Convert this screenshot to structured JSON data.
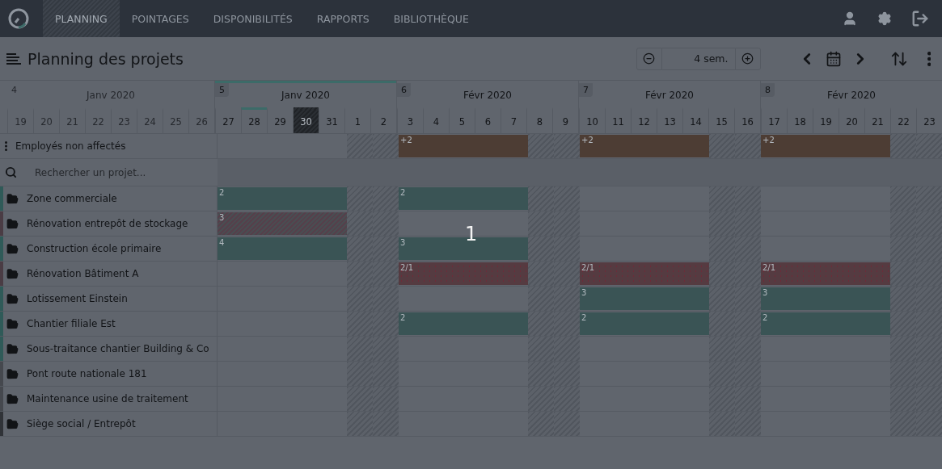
{
  "nav": {
    "tabs": [
      {
        "label": "PLANNING",
        "selected": true
      },
      {
        "label": "POINTAGES",
        "selected": false
      },
      {
        "label": "DISPONIBILITÉS",
        "selected": false
      },
      {
        "label": "RAPPORTS",
        "selected": false
      },
      {
        "label": "BIBLIOTHÈQUE",
        "selected": false
      }
    ]
  },
  "toolbar": {
    "title": "Planning des projets",
    "zoom_value": "4 sem."
  },
  "timeline": {
    "past_week": {
      "number": "4",
      "label": "Janv 2020",
      "days": [
        "19",
        "20",
        "21",
        "22",
        "23",
        "24",
        "25",
        "26"
      ]
    },
    "weeks": [
      {
        "number": "5",
        "label": "Janv 2020",
        "current": true,
        "days": [
          {
            "label": "27",
            "weekend": false,
            "today": false,
            "selected": false
          },
          {
            "label": "28",
            "weekend": false,
            "today": true,
            "selected": false
          },
          {
            "label": "29",
            "weekend": false,
            "today": false,
            "selected": false
          },
          {
            "label": "30",
            "weekend": false,
            "today": false,
            "selected": true
          },
          {
            "label": "31",
            "weekend": false,
            "today": false,
            "selected": false
          },
          {
            "label": "1",
            "weekend": true,
            "today": false,
            "selected": false
          },
          {
            "label": "2",
            "weekend": true,
            "today": false,
            "selected": false
          }
        ]
      },
      {
        "number": "6",
        "label": "Févr 2020",
        "current": false,
        "days": [
          {
            "label": "3",
            "weekend": false,
            "today": false,
            "selected": false
          },
          {
            "label": "4",
            "weekend": false,
            "today": false,
            "selected": false
          },
          {
            "label": "5",
            "weekend": false,
            "today": false,
            "selected": false
          },
          {
            "label": "6",
            "weekend": false,
            "today": false,
            "selected": false
          },
          {
            "label": "7",
            "weekend": false,
            "today": false,
            "selected": false
          },
          {
            "label": "8",
            "weekend": true,
            "today": false,
            "selected": false
          },
          {
            "label": "9",
            "weekend": true,
            "today": false,
            "selected": false
          }
        ]
      },
      {
        "number": "7",
        "label": "Févr 2020",
        "current": false,
        "days": [
          {
            "label": "10",
            "weekend": false,
            "today": false,
            "selected": false
          },
          {
            "label": "11",
            "weekend": false,
            "today": false,
            "selected": false
          },
          {
            "label": "12",
            "weekend": false,
            "today": false,
            "selected": false
          },
          {
            "label": "13",
            "weekend": false,
            "today": false,
            "selected": false
          },
          {
            "label": "14",
            "weekend": false,
            "today": false,
            "selected": false
          },
          {
            "label": "15",
            "weekend": true,
            "today": false,
            "selected": false
          },
          {
            "label": "16",
            "weekend": true,
            "today": false,
            "selected": false
          }
        ]
      },
      {
        "number": "8",
        "label": "Févr 2020",
        "current": false,
        "days": [
          {
            "label": "17",
            "weekend": false,
            "today": false,
            "selected": false
          },
          {
            "label": "18",
            "weekend": false,
            "today": false,
            "selected": false
          },
          {
            "label": "19",
            "weekend": false,
            "today": false,
            "selected": false
          },
          {
            "label": "20",
            "weekend": false,
            "today": false,
            "selected": false
          },
          {
            "label": "21",
            "weekend": false,
            "today": false,
            "selected": false
          },
          {
            "label": "22",
            "weekend": true,
            "today": false,
            "selected": false
          },
          {
            "label": "23",
            "weekend": true,
            "today": false,
            "selected": false
          }
        ]
      }
    ]
  },
  "unassigned": {
    "label": "Employés non affectés",
    "weeks": [
      {
        "kind": "none"
      },
      {
        "kind": "orange",
        "text": "+2"
      },
      {
        "kind": "orange",
        "text": "+2"
      },
      {
        "kind": "orange",
        "text": "+2"
      }
    ]
  },
  "search": {
    "placeholder": "Rechercher un projet..."
  },
  "projects": [
    {
      "name": "Zone commerciale",
      "color": "#2f5a58",
      "weeks": [
        {
          "kind": "teal",
          "text": "2"
        },
        {
          "kind": "teal",
          "text": "2"
        }
      ]
    },
    {
      "name": "Rénovation entrepôt de stockage",
      "color": "#4a3c44",
      "weeks": [
        {
          "kind": "dotted",
          "text": "3"
        }
      ]
    },
    {
      "name": "Construction école primaire",
      "color": "#2f5a58",
      "weeks": [
        {
          "kind": "teal",
          "text": "4"
        },
        {
          "kind": "teal",
          "text": "3"
        }
      ]
    },
    {
      "name": "Rénovation Bâtiment A",
      "color": "#4a3c44",
      "weeks": [
        {
          "kind": "none"
        },
        {
          "kind": "red",
          "text": "2/1"
        },
        {
          "kind": "red",
          "text": "2/1"
        },
        {
          "kind": "red",
          "text": "2/1"
        }
      ]
    },
    {
      "name": "Lotissement Einstein",
      "color": "#2f5a58",
      "weeks": [
        {
          "kind": "none"
        },
        {
          "kind": "none"
        },
        {
          "kind": "teal",
          "text": "3"
        },
        {
          "kind": "teal",
          "text": "3"
        }
      ]
    },
    {
      "name": "Chantier filiale Est",
      "color": "#2f5a58",
      "weeks": [
        {
          "kind": "none"
        },
        {
          "kind": "teal",
          "text": "2"
        },
        {
          "kind": "teal",
          "text": "2"
        },
        {
          "kind": "teal",
          "text": "2"
        }
      ]
    },
    {
      "name": "Sous-traitance chantier Building & Co",
      "color": "#2f5a58"
    },
    {
      "name": "Pont route nationale 181",
      "color": "#45484e"
    },
    {
      "name": "Maintenance usine de traitement",
      "color": "#45484e"
    },
    {
      "name": "Siège social / Entrepôt",
      "color": "#303338"
    }
  ],
  "step_marker": "1"
}
